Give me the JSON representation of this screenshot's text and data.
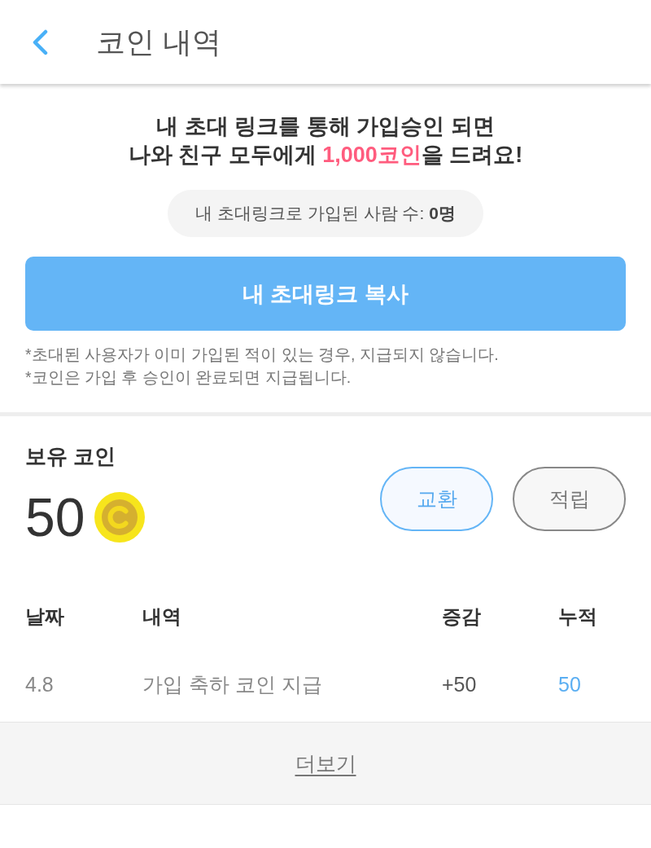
{
  "header": {
    "title": "코인 내역"
  },
  "invite": {
    "headline": {
      "line_1": "내 초대 링크를 통해 가입승인 되면",
      "line_2": [
        {
          "text": "나와 친구 모두에게 ",
          "highlight": false
        },
        {
          "text": "1,000코인",
          "highlight": true
        },
        {
          "text": "을 드려요!",
          "highlight": false
        }
      ]
    },
    "referral_count": "내 초대링크로 가입된 사람 수: **0명**",
    "copy_button": "내 초대링크 복사",
    "notes": [
      "*초대된 사용자가 이미 가입된 적이 있는 경우, 지급되지 않습니다.",
      "*코인은 가입 후 승인이 완료되면 지급됩니다."
    ]
  },
  "balance": {
    "label": "보유 코인",
    "amount": "50",
    "buttons": [
      {
        "label": "교환",
        "kind": "primary"
      },
      {
        "label": "적립",
        "kind": "secondary"
      }
    ]
  },
  "history": {
    "columns": [
      "날짜",
      "내역",
      "증감",
      "누적"
    ],
    "rows": [
      {
        "date": "4.8",
        "description": "가입 축하 코인 지급",
        "change": "+50",
        "total": "50"
      }
    ],
    "more": "더보기"
  }
}
